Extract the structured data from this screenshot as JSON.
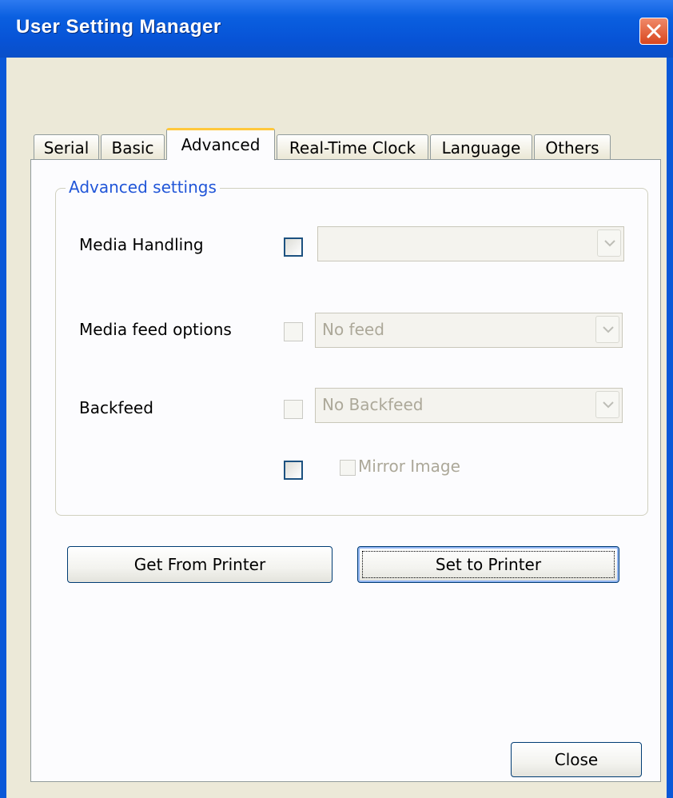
{
  "window": {
    "title": "User Setting Manager"
  },
  "tabs": [
    {
      "label": "Serial",
      "active": false
    },
    {
      "label": "Basic",
      "active": false
    },
    {
      "label": "Advanced",
      "active": true
    },
    {
      "label": "Real-Time Clock",
      "active": false
    },
    {
      "label": "Language",
      "active": false
    },
    {
      "label": "Others",
      "active": false
    }
  ],
  "advanced": {
    "group_title": "Advanced settings",
    "rows": [
      {
        "label": "Media Handling",
        "checkbox_enabled": true,
        "checked": false,
        "value": ""
      },
      {
        "label": "Media feed options",
        "checkbox_enabled": false,
        "checked": false,
        "value": "No feed"
      },
      {
        "label": "Backfeed",
        "checkbox_enabled": false,
        "checked": false,
        "value": "No Backfeed"
      }
    ],
    "mirror": {
      "label": "Mirror Image",
      "checkbox_enabled": true,
      "checked": false
    }
  },
  "buttons": {
    "get_from_printer": "Get From Printer",
    "set_to_printer": "Set to Printer",
    "close": "Close"
  },
  "colors": {
    "titlebar": "#0a58d8",
    "group_title": "#2156d8",
    "dialog_bg": "#ece9d8",
    "tab_active_border": "#ffc83c"
  }
}
